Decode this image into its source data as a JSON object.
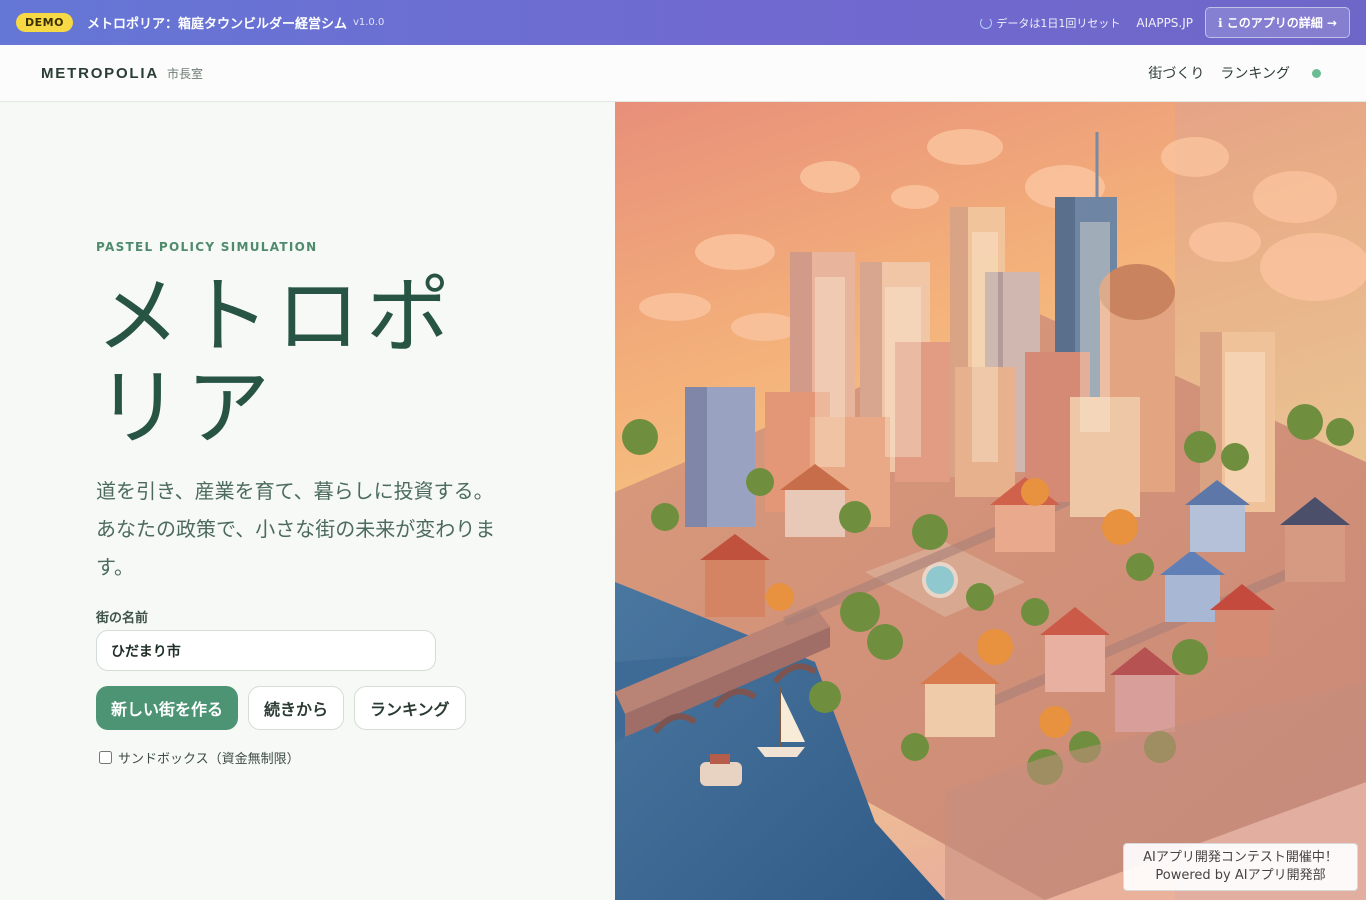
{
  "demo_bar": {
    "badge": "DEMO",
    "title": "メトロポリア：箱庭タウンビルダー経営シム",
    "version": "v1.0.0",
    "reset_note": "データは1日1回リセット",
    "site": "AIAPPS.JP",
    "detail_button": "ℹ このアプリの詳細 →"
  },
  "header": {
    "logo": "METROPOLIA",
    "logo_sub": "市長室",
    "nav": [
      "街づくり",
      "ランキング"
    ],
    "status_color": "#6cbc93"
  },
  "hero": {
    "kicker": "PASTEL POLICY SIMULATION",
    "title": "メトロポリア",
    "lead": "道を引き、産業を育て、暮らしに投資する。あなたの政策で、小さな街の未来が変わります。",
    "field_label": "街の名前",
    "city_name": "ひだまり市",
    "buttons": {
      "new_city": "新しい街を作る",
      "continue": "続きから",
      "ranking": "ランキング"
    },
    "sandbox_label": "サンドボックス（資金無制限）"
  },
  "footer_note": {
    "line1": "AIアプリ開発コンテスト開催中！",
    "line2": "Powered by AIアプリ開発部"
  },
  "colors": {
    "accent": "#4c9474",
    "title": "#275445",
    "demo_bar": "#6577d6"
  }
}
